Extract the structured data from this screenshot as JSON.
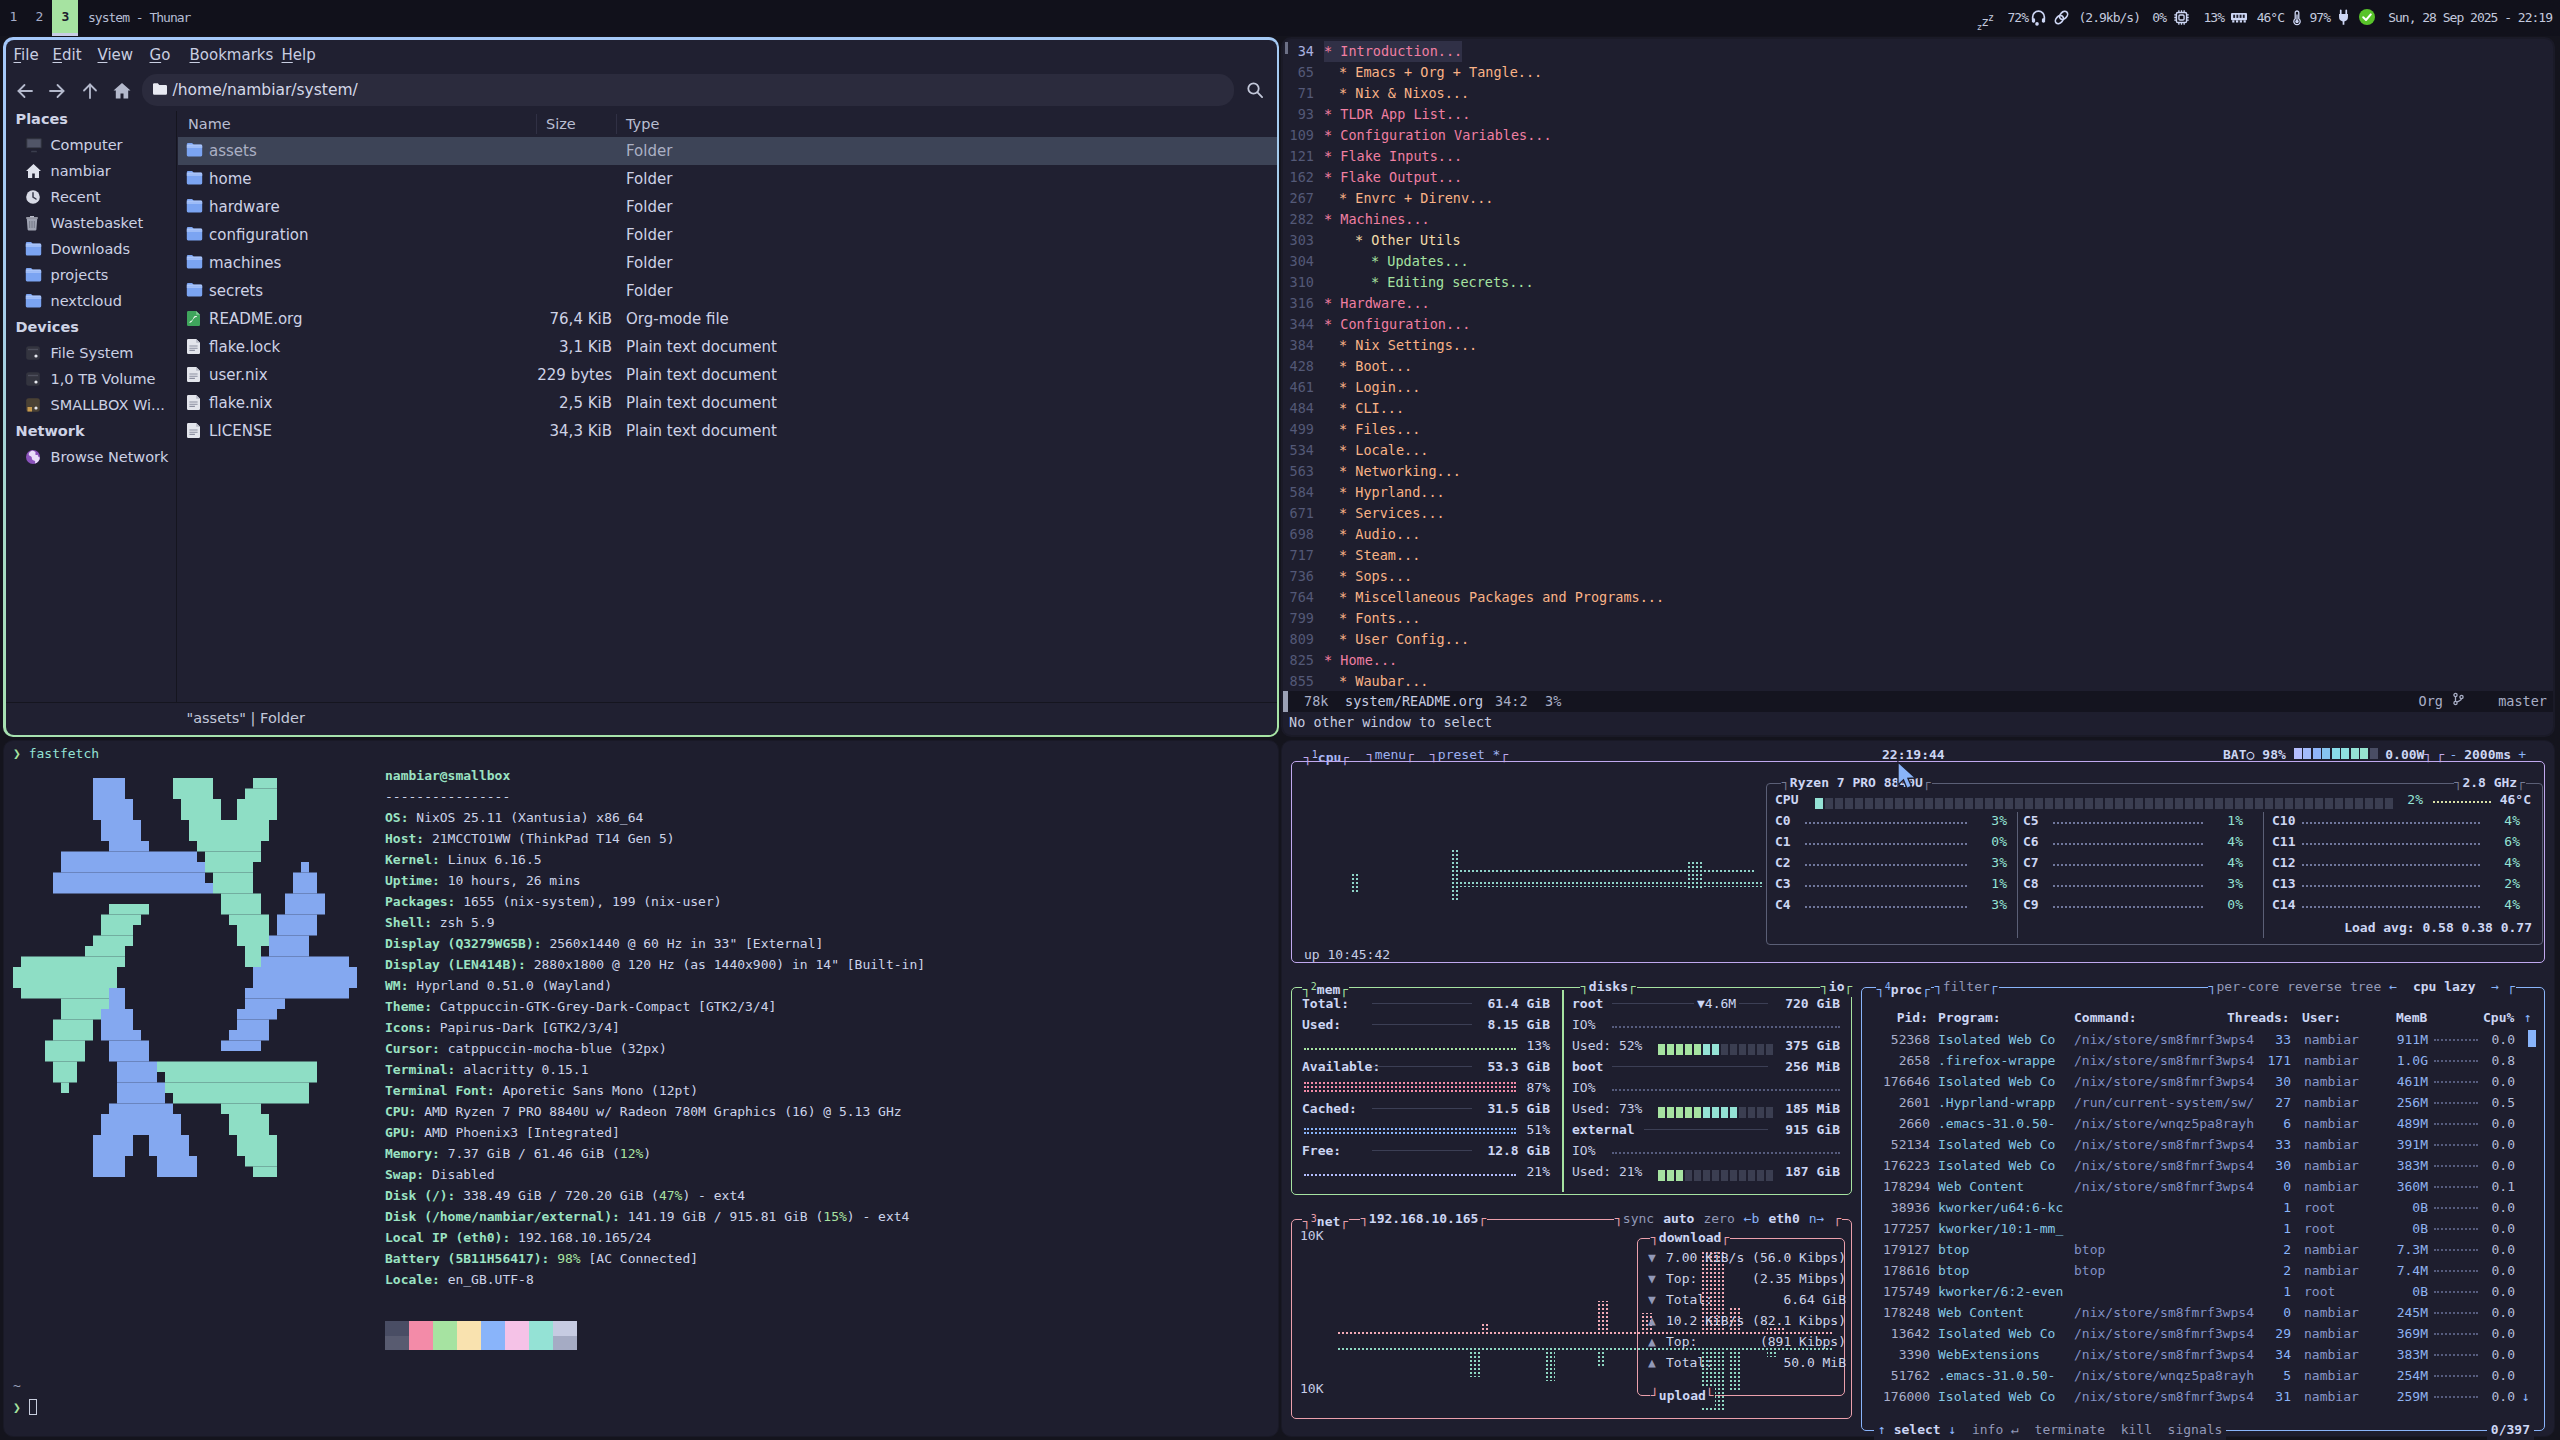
{
  "waybar": {
    "workspaces": [
      {
        "label": "1",
        "active": false
      },
      {
        "label": "2",
        "active": false
      },
      {
        "label": "3",
        "active": true
      }
    ],
    "window_title": "system - Thunar",
    "modules": {
      "idle": "zzz",
      "volume": "72%",
      "network_speed": "(2.9kb/s)",
      "cpu": "0%",
      "memory": "13%",
      "temperature": "46°C",
      "battery": "97%",
      "clock": "Sun, 28 Sep 2025 - 22:19"
    }
  },
  "thunar": {
    "menu": [
      "File",
      "Edit",
      "View",
      "Go",
      "Bookmarks",
      "Help"
    ],
    "path": "/home/nambiar/system/",
    "sidebar": [
      {
        "title": "Places",
        "items": [
          {
            "label": "Computer",
            "icon": "computer"
          },
          {
            "label": "nambiar",
            "icon": "home"
          },
          {
            "label": "Recent",
            "icon": "recent"
          },
          {
            "label": "Wastebasket",
            "icon": "trash"
          },
          {
            "label": "Downloads",
            "icon": "folder"
          },
          {
            "label": "projects",
            "icon": "folder"
          },
          {
            "label": "nextcloud",
            "icon": "folder"
          }
        ]
      },
      {
        "title": "Devices",
        "items": [
          {
            "label": "File System",
            "icon": "drive"
          },
          {
            "label": "1,0 TB Volume",
            "icon": "drive"
          },
          {
            "label": "SMALLBOX Wi...",
            "icon": "drive2"
          }
        ]
      },
      {
        "title": "Network",
        "items": [
          {
            "label": "Browse Network",
            "icon": "globe"
          }
        ]
      }
    ],
    "columns": [
      "Name",
      "Size",
      "Type"
    ],
    "rows": [
      {
        "name": "assets",
        "size": "",
        "type": "Folder",
        "icon": "folder",
        "selected": true
      },
      {
        "name": "home",
        "size": "",
        "type": "Folder",
        "icon": "folder",
        "selected": false
      },
      {
        "name": "hardware",
        "size": "",
        "type": "Folder",
        "icon": "folder",
        "selected": false
      },
      {
        "name": "configuration",
        "size": "",
        "type": "Folder",
        "icon": "folder",
        "selected": false
      },
      {
        "name": "machines",
        "size": "",
        "type": "Folder",
        "icon": "folder",
        "selected": false
      },
      {
        "name": "secrets",
        "size": "",
        "type": "Folder",
        "icon": "folder",
        "selected": false
      },
      {
        "name": "README.org",
        "size": "76,4 KiB",
        "type": "Org-mode file",
        "icon": "org",
        "selected": false
      },
      {
        "name": "flake.lock",
        "size": "3,1 KiB",
        "type": "Plain text document",
        "icon": "text",
        "selected": false
      },
      {
        "name": "user.nix",
        "size": "229 bytes",
        "type": "Plain text document",
        "icon": "text",
        "selected": false
      },
      {
        "name": "flake.nix",
        "size": "2,5 KiB",
        "type": "Plain text document",
        "icon": "text",
        "selected": false
      },
      {
        "name": "LICENSE",
        "size": "34,3 KiB",
        "type": "Plain text document",
        "icon": "text",
        "selected": false
      }
    ],
    "statusbar": "\"assets\"  |  Folder"
  },
  "emacs": {
    "lines": [
      {
        "num": "34",
        "level": 1,
        "title": "Introduction...",
        "color": "pink",
        "hl": true,
        "cur": true
      },
      {
        "num": "65",
        "level": 2,
        "title": "Emacs + Org + Tangle...",
        "color": "peach"
      },
      {
        "num": "71",
        "level": 2,
        "title": "Nix & Nixos...",
        "color": "peach"
      },
      {
        "num": "93",
        "level": 1,
        "title": "TLDR App List...",
        "color": "pink"
      },
      {
        "num": "109",
        "level": 1,
        "title": "Configuration Variables...",
        "color": "pink"
      },
      {
        "num": "121",
        "level": 1,
        "title": "Flake Inputs...",
        "color": "pink"
      },
      {
        "num": "162",
        "level": 1,
        "title": "Flake Output...",
        "color": "pink"
      },
      {
        "num": "267",
        "level": 2,
        "title": "Envrc + Direnv...",
        "color": "peach"
      },
      {
        "num": "282",
        "level": 1,
        "title": "Machines...",
        "color": "pink"
      },
      {
        "num": "303",
        "level": 3,
        "title": "Other Utils",
        "color": "yellow"
      },
      {
        "num": "304",
        "level": 4,
        "title": "Updates...",
        "color": "green"
      },
      {
        "num": "310",
        "level": 4,
        "title": "Editing secrets...",
        "color": "green"
      },
      {
        "num": "316",
        "level": 1,
        "title": "Hardware...",
        "color": "pink"
      },
      {
        "num": "344",
        "level": 1,
        "title": "Configuration...",
        "color": "pink"
      },
      {
        "num": "384",
        "level": 2,
        "title": "Nix Settings...",
        "color": "peach"
      },
      {
        "num": "428",
        "level": 2,
        "title": "Boot...",
        "color": "peach"
      },
      {
        "num": "461",
        "level": 2,
        "title": "Login...",
        "color": "peach"
      },
      {
        "num": "484",
        "level": 2,
        "title": "CLI...",
        "color": "peach"
      },
      {
        "num": "499",
        "level": 2,
        "title": "Files...",
        "color": "peach"
      },
      {
        "num": "534",
        "level": 2,
        "title": "Locale...",
        "color": "peach"
      },
      {
        "num": "563",
        "level": 2,
        "title": "Networking...",
        "color": "peach"
      },
      {
        "num": "584",
        "level": 2,
        "title": "Hyprland...",
        "color": "peach"
      },
      {
        "num": "671",
        "level": 2,
        "title": "Services...",
        "color": "peach"
      },
      {
        "num": "698",
        "level": 2,
        "title": "Audio...",
        "color": "peach"
      },
      {
        "num": "717",
        "level": 2,
        "title": "Steam...",
        "color": "peach"
      },
      {
        "num": "736",
        "level": 2,
        "title": "Sops...",
        "color": "peach"
      },
      {
        "num": "764",
        "level": 2,
        "title": "Miscellaneous Packages and Programs...",
        "color": "peach"
      },
      {
        "num": "799",
        "level": 2,
        "title": "Fonts...",
        "color": "peach"
      },
      {
        "num": "809",
        "level": 2,
        "title": "User Config...",
        "color": "peach"
      },
      {
        "num": "825",
        "level": 1,
        "title": "Home...",
        "color": "pink"
      },
      {
        "num": "855",
        "level": 2,
        "title": "Waubar...",
        "color": "peach"
      }
    ],
    "modeline": {
      "size": "78k",
      "buffer": "system/README.org",
      "position": "34:2",
      "percent": "3%",
      "mode": "Org",
      "branch": "master"
    },
    "echo": "No other window to select"
  },
  "fastfetch": {
    "prompt_command": "fastfetch",
    "title": "nambiar@smallbox",
    "separator": "----------------",
    "entries": [
      {
        "label": "OS",
        "value": "NixOS 25.11 (Xantusia) x86_64"
      },
      {
        "label": "Host",
        "value": "21MCCTO1WW (ThinkPad T14 Gen 5)"
      },
      {
        "label": "Kernel",
        "value": "Linux 6.16.5"
      },
      {
        "label": "Uptime",
        "value": "10 hours, 26 mins"
      },
      {
        "label": "Packages",
        "value": "1655 (nix-system), 199 (nix-user)"
      },
      {
        "label": "Shell",
        "value": "zsh 5.9"
      },
      {
        "label": "Display (Q3279WG5B)",
        "value": "2560x1440 @ 60 Hz in 33\" [External]"
      },
      {
        "label": "Display (LEN414B)",
        "value": "2880x1800 @ 120 Hz (as 1440x900) in 14\" [Built-in]"
      },
      {
        "label": "WM",
        "value": "Hyprland 0.51.0 (Wayland)"
      },
      {
        "label": "Theme",
        "value": "Catppuccin-GTK-Grey-Dark-Compact [GTK2/3/4]"
      },
      {
        "label": "Icons",
        "value": "Papirus-Dark [GTK2/3/4]"
      },
      {
        "label": "Cursor",
        "value": "catppuccin-mocha-blue (32px)"
      },
      {
        "label": "Terminal",
        "value": "alacritty 0.15.1"
      },
      {
        "label": "Terminal Font",
        "value": "Aporetic Sans Mono (12pt)"
      },
      {
        "label": "CPU",
        "value": "AMD Ryzen 7 PRO 8840U w/ Radeon 780M Graphics (16) @ 5.13 GHz"
      },
      {
        "label": "GPU",
        "value": "AMD Phoenix3 [Integrated]"
      },
      {
        "label": "Memory",
        "value": "7.37 GiB / 61.46 GiB (",
        "pct": "12%",
        "suffix": ")"
      },
      {
        "label": "Swap",
        "value": "Disabled"
      },
      {
        "label": "Disk (/)",
        "value": "338.49 GiB / 720.20 GiB (",
        "pct": "47%",
        "suffix": ") - ext4"
      },
      {
        "label": "Disk (/home/nambiar/external)",
        "value": "141.19 GiB / 915.81 GiB (",
        "pct": "15%",
        "suffix": ") - ext4"
      },
      {
        "label": "Local IP (eth0)",
        "value": "192.168.10.165/24"
      },
      {
        "label": "Battery (5B11H56417)",
        "value": "",
        "pct": "98%",
        "suffix": " [AC Connected]"
      },
      {
        "label": "Locale",
        "value": "en_GB.UTF-8"
      }
    ],
    "palette_row1": [
      "#494d64",
      "#f38ba8",
      "#a6e3a1",
      "#f9e2af",
      "#89b4fa",
      "#f5c2e7",
      "#94e2d5",
      "#c6cbe2"
    ],
    "palette_row2": [
      "#585b70",
      "#f38ba8",
      "#a6e3a1",
      "#f9e2af",
      "#89b4fa",
      "#f5c2e7",
      "#94e2d5",
      "#a5abc4"
    ],
    "tilde": "~"
  },
  "btop": {
    "tabs": {
      "cpu": "cpu",
      "menu": "menu",
      "preset": "preset *"
    },
    "clock": "22:19:44",
    "battery": {
      "label": "BAT○",
      "percent": "98%",
      "watts": "0.00W"
    },
    "refresh": {
      "minus": "-",
      "interval": "2000ms",
      "plus": "+"
    },
    "cpu_name": "Ryzen 7 PRO 8840U",
    "freq": "2.8 GHz",
    "cpu_total": {
      "label": "CPU",
      "percent": "2%",
      "temp": "46°C"
    },
    "cores": [
      {
        "name": "C0",
        "pct": "3%"
      },
      {
        "name": "C1",
        "pct": "0%"
      },
      {
        "name": "C2",
        "pct": "3%"
      },
      {
        "name": "C3",
        "pct": "1%"
      },
      {
        "name": "C4",
        "pct": "3%"
      },
      {
        "name": "C5",
        "pct": "1%"
      },
      {
        "name": "C6",
        "pct": "4%"
      },
      {
        "name": "C7",
        "pct": "4%"
      },
      {
        "name": "C8",
        "pct": "3%"
      },
      {
        "name": "C9",
        "pct": "0%"
      },
      {
        "name": "C10",
        "pct": "4%"
      },
      {
        "name": "C11",
        "pct": "6%"
      },
      {
        "name": "C12",
        "pct": "4%"
      },
      {
        "name": "C13",
        "pct": "2%"
      },
      {
        "name": "C14",
        "pct": "4%"
      }
    ],
    "load_avg": "Load avg: 0.58 0.38 0.77",
    "uptime": "up 10:45:42",
    "mem": {
      "title": "mem",
      "rows": [
        {
          "label": "Total:",
          "value": "61.4 GiB",
          "pct": null
        },
        {
          "label": "Used:",
          "value": "8.15 GiB",
          "pct": "13%",
          "meter": "green",
          "rows": 1
        },
        {
          "label": "Available:",
          "value": "53.3 GiB",
          "pct": "87%",
          "meter": "red",
          "rows": 3
        },
        {
          "label": "Cached:",
          "value": "31.5 GiB",
          "pct": "51%",
          "meter": "blue",
          "rows": 2
        },
        {
          "label": "Free:",
          "value": "12.8 GiB",
          "pct": "21%",
          "meter": "lav",
          "rows": 1
        }
      ]
    },
    "disks": {
      "title": "disks",
      "io_label": "io",
      "items": [
        {
          "name": "root",
          "extra": "▼4.6M",
          "total": "720 GiB",
          "io": "IO%",
          "used_pct": "Used: 52%",
          "used_val": "375 GiB",
          "frac": 0.52
        },
        {
          "name": "boot",
          "extra": "",
          "total": "256 MiB",
          "io": "IO%",
          "used_pct": "Used: 73%",
          "used_val": "185 MiB",
          "frac": 0.73
        },
        {
          "name": "external",
          "extra": "",
          "total": "915 GiB",
          "io": "IO%",
          "used_pct": "Used: 21%",
          "used_val": "187 GiB",
          "frac": 0.21
        }
      ]
    },
    "net": {
      "title": "net",
      "ip": "192.168.10.165",
      "opts": [
        {
          "t": "sync",
          "c": "dim"
        },
        {
          "t": "auto",
          "c": "bb"
        },
        {
          "t": "zero",
          "c": "dim"
        },
        {
          "t": "←b",
          "c": "t-blue"
        },
        {
          "t": "eth0",
          "c": "bb"
        },
        {
          "t": "n→",
          "c": "t-blue"
        }
      ],
      "scale_top": "10K",
      "scale_bottom": "10K",
      "download_label": "download",
      "upload_label": "upload",
      "stats": [
        {
          "dir": "down",
          "text": "7.00 KiB/s (56.0 Kibps)"
        },
        {
          "dir": "down",
          "text": "Top:       (2.35 Mibps)"
        },
        {
          "dir": "down",
          "text": "Total:         6.64 GiB"
        },
        {
          "dir": "up",
          "text": "10.2 KiB/s (82.1 Kibps)"
        },
        {
          "dir": "up",
          "text": "Top:        (891 Kibps)"
        },
        {
          "dir": "up",
          "text": "Total:         50.0 MiB"
        }
      ]
    },
    "proc": {
      "title": "proc",
      "filter": "filter",
      "opts_right": [
        {
          "t": "per-core",
          "c": "dim"
        },
        {
          "t": "reverse",
          "c": "dim"
        },
        {
          "t": "tree",
          "c": "dim"
        },
        {
          "t": "←",
          "c": "t-blue"
        },
        {
          "t": " cpu lazy ",
          "c": "bb"
        },
        {
          "t": "→",
          "c": "t-blue"
        }
      ],
      "columns": {
        "pid": "Pid:",
        "program": "Program:",
        "command": "Command:",
        "threads": "Threads:",
        "user": "User:",
        "mem": "MemB",
        "cpu": "Cpu%"
      },
      "rows": [
        {
          "pid": "52368",
          "prog": "Isolated Web Co",
          "cmd": "/nix/store/sm8fmrf3wps4",
          "thr": "33",
          "usr": "nambiar",
          "mem": "911M",
          "cpu": "0.0"
        },
        {
          "pid": "2658",
          "prog": ".firefox-wrappe",
          "cmd": "/nix/store/sm8fmrf3wps4",
          "thr": "171",
          "usr": "nambiar",
          "mem": "1.0G",
          "cpu": "0.8"
        },
        {
          "pid": "176646",
          "prog": "Isolated Web Co",
          "cmd": "/nix/store/sm8fmrf3wps4",
          "thr": "30",
          "usr": "nambiar",
          "mem": "461M",
          "cpu": "0.0"
        },
        {
          "pid": "2601",
          "prog": ".Hyprland-wrapp",
          "cmd": "/run/current-system/sw/",
          "thr": "27",
          "usr": "nambiar",
          "mem": "256M",
          "cpu": "0.5"
        },
        {
          "pid": "2660",
          "prog": ".emacs-31.0.50-",
          "cmd": "/nix/store/wnqz5pa8rayh",
          "thr": "6",
          "usr": "nambiar",
          "mem": "489M",
          "cpu": "0.0"
        },
        {
          "pid": "52134",
          "prog": "Isolated Web Co",
          "cmd": "/nix/store/sm8fmrf3wps4",
          "thr": "33",
          "usr": "nambiar",
          "mem": "391M",
          "cpu": "0.0"
        },
        {
          "pid": "176223",
          "prog": "Isolated Web Co",
          "cmd": "/nix/store/sm8fmrf3wps4",
          "thr": "30",
          "usr": "nambiar",
          "mem": "383M",
          "cpu": "0.0"
        },
        {
          "pid": "178294",
          "prog": "Web Content",
          "cmd": "/nix/store/sm8fmrf3wps4",
          "thr": "0",
          "usr": "nambiar",
          "mem": "360M",
          "cpu": "0.1"
        },
        {
          "pid": "38936",
          "prog": "kworker/u64:6-kc",
          "cmd": "",
          "thr": "1",
          "usr": "root",
          "mem": "0B",
          "cpu": "0.0"
        },
        {
          "pid": "177257",
          "prog": "kworker/10:1-mm_",
          "cmd": "",
          "thr": "1",
          "usr": "root",
          "mem": "0B",
          "cpu": "0.0"
        },
        {
          "pid": "179127",
          "prog": "btop",
          "cmd": "btop",
          "thr": "2",
          "usr": "nambiar",
          "mem": "7.3M",
          "cpu": "0.0"
        },
        {
          "pid": "178616",
          "prog": "btop",
          "cmd": "btop",
          "thr": "2",
          "usr": "nambiar",
          "mem": "7.4M",
          "cpu": "0.0"
        },
        {
          "pid": "175749",
          "prog": "kworker/6:2-even",
          "cmd": "",
          "thr": "1",
          "usr": "root",
          "mem": "0B",
          "cpu": "0.0"
        },
        {
          "pid": "178248",
          "prog": "Web Content",
          "cmd": "/nix/store/sm8fmrf3wps4",
          "thr": "0",
          "usr": "nambiar",
          "mem": "245M",
          "cpu": "0.0"
        },
        {
          "pid": "13642",
          "prog": "Isolated Web Co",
          "cmd": "/nix/store/sm8fmrf3wps4",
          "thr": "29",
          "usr": "nambiar",
          "mem": "369M",
          "cpu": "0.0"
        },
        {
          "pid": "3390",
          "prog": "WebExtensions",
          "cmd": "/nix/store/sm8fmrf3wps4",
          "thr": "34",
          "usr": "nambiar",
          "mem": "383M",
          "cpu": "0.0"
        },
        {
          "pid": "51762",
          "prog": ".emacs-31.0.50-",
          "cmd": "/nix/store/wnqz5pa8rayh",
          "thr": "5",
          "usr": "nambiar",
          "mem": "254M",
          "cpu": "0.0"
        },
        {
          "pid": "176000",
          "prog": "Isolated Web Co",
          "cmd": "/nix/store/sm8fmrf3wps4",
          "thr": "31",
          "usr": "nambiar",
          "mem": "259M",
          "cpu": "0.0"
        }
      ],
      "footer": [
        {
          "t": "↑ ",
          "c": "t-blue"
        },
        {
          "t": "select",
          "c": "bb"
        },
        {
          "t": " ↓",
          "c": "t-blue"
        },
        {
          "t": "  info ↵",
          "c": "dim"
        },
        {
          "t": "  terminate",
          "c": "dim"
        },
        {
          "t": "  kill",
          "c": "dim"
        },
        {
          "t": "  signals",
          "c": "dim"
        }
      ],
      "count": "0/397"
    }
  }
}
